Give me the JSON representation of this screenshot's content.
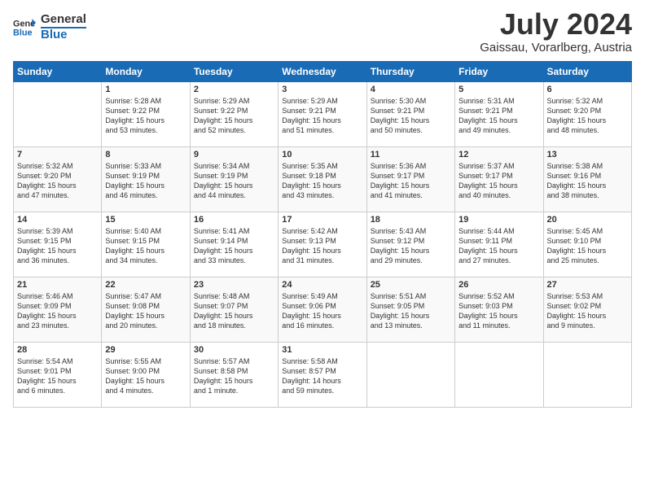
{
  "header": {
    "logo_line1": "General",
    "logo_line2": "Blue",
    "month": "July 2024",
    "location": "Gaissau, Vorarlberg, Austria"
  },
  "days_of_week": [
    "Sunday",
    "Monday",
    "Tuesday",
    "Wednesday",
    "Thursday",
    "Friday",
    "Saturday"
  ],
  "weeks": [
    [
      {
        "day": "",
        "info": ""
      },
      {
        "day": "1",
        "info": "Sunrise: 5:28 AM\nSunset: 9:22 PM\nDaylight: 15 hours\nand 53 minutes."
      },
      {
        "day": "2",
        "info": "Sunrise: 5:29 AM\nSunset: 9:22 PM\nDaylight: 15 hours\nand 52 minutes."
      },
      {
        "day": "3",
        "info": "Sunrise: 5:29 AM\nSunset: 9:21 PM\nDaylight: 15 hours\nand 51 minutes."
      },
      {
        "day": "4",
        "info": "Sunrise: 5:30 AM\nSunset: 9:21 PM\nDaylight: 15 hours\nand 50 minutes."
      },
      {
        "day": "5",
        "info": "Sunrise: 5:31 AM\nSunset: 9:21 PM\nDaylight: 15 hours\nand 49 minutes."
      },
      {
        "day": "6",
        "info": "Sunrise: 5:32 AM\nSunset: 9:20 PM\nDaylight: 15 hours\nand 48 minutes."
      }
    ],
    [
      {
        "day": "7",
        "info": "Sunrise: 5:32 AM\nSunset: 9:20 PM\nDaylight: 15 hours\nand 47 minutes."
      },
      {
        "day": "8",
        "info": "Sunrise: 5:33 AM\nSunset: 9:19 PM\nDaylight: 15 hours\nand 46 minutes."
      },
      {
        "day": "9",
        "info": "Sunrise: 5:34 AM\nSunset: 9:19 PM\nDaylight: 15 hours\nand 44 minutes."
      },
      {
        "day": "10",
        "info": "Sunrise: 5:35 AM\nSunset: 9:18 PM\nDaylight: 15 hours\nand 43 minutes."
      },
      {
        "day": "11",
        "info": "Sunrise: 5:36 AM\nSunset: 9:17 PM\nDaylight: 15 hours\nand 41 minutes."
      },
      {
        "day": "12",
        "info": "Sunrise: 5:37 AM\nSunset: 9:17 PM\nDaylight: 15 hours\nand 40 minutes."
      },
      {
        "day": "13",
        "info": "Sunrise: 5:38 AM\nSunset: 9:16 PM\nDaylight: 15 hours\nand 38 minutes."
      }
    ],
    [
      {
        "day": "14",
        "info": "Sunrise: 5:39 AM\nSunset: 9:15 PM\nDaylight: 15 hours\nand 36 minutes."
      },
      {
        "day": "15",
        "info": "Sunrise: 5:40 AM\nSunset: 9:15 PM\nDaylight: 15 hours\nand 34 minutes."
      },
      {
        "day": "16",
        "info": "Sunrise: 5:41 AM\nSunset: 9:14 PM\nDaylight: 15 hours\nand 33 minutes."
      },
      {
        "day": "17",
        "info": "Sunrise: 5:42 AM\nSunset: 9:13 PM\nDaylight: 15 hours\nand 31 minutes."
      },
      {
        "day": "18",
        "info": "Sunrise: 5:43 AM\nSunset: 9:12 PM\nDaylight: 15 hours\nand 29 minutes."
      },
      {
        "day": "19",
        "info": "Sunrise: 5:44 AM\nSunset: 9:11 PM\nDaylight: 15 hours\nand 27 minutes."
      },
      {
        "day": "20",
        "info": "Sunrise: 5:45 AM\nSunset: 9:10 PM\nDaylight: 15 hours\nand 25 minutes."
      }
    ],
    [
      {
        "day": "21",
        "info": "Sunrise: 5:46 AM\nSunset: 9:09 PM\nDaylight: 15 hours\nand 23 minutes."
      },
      {
        "day": "22",
        "info": "Sunrise: 5:47 AM\nSunset: 9:08 PM\nDaylight: 15 hours\nand 20 minutes."
      },
      {
        "day": "23",
        "info": "Sunrise: 5:48 AM\nSunset: 9:07 PM\nDaylight: 15 hours\nand 18 minutes."
      },
      {
        "day": "24",
        "info": "Sunrise: 5:49 AM\nSunset: 9:06 PM\nDaylight: 15 hours\nand 16 minutes."
      },
      {
        "day": "25",
        "info": "Sunrise: 5:51 AM\nSunset: 9:05 PM\nDaylight: 15 hours\nand 13 minutes."
      },
      {
        "day": "26",
        "info": "Sunrise: 5:52 AM\nSunset: 9:03 PM\nDaylight: 15 hours\nand 11 minutes."
      },
      {
        "day": "27",
        "info": "Sunrise: 5:53 AM\nSunset: 9:02 PM\nDaylight: 15 hours\nand 9 minutes."
      }
    ],
    [
      {
        "day": "28",
        "info": "Sunrise: 5:54 AM\nSunset: 9:01 PM\nDaylight: 15 hours\nand 6 minutes."
      },
      {
        "day": "29",
        "info": "Sunrise: 5:55 AM\nSunset: 9:00 PM\nDaylight: 15 hours\nand 4 minutes."
      },
      {
        "day": "30",
        "info": "Sunrise: 5:57 AM\nSunset: 8:58 PM\nDaylight: 15 hours\nand 1 minute."
      },
      {
        "day": "31",
        "info": "Sunrise: 5:58 AM\nSunset: 8:57 PM\nDaylight: 14 hours\nand 59 minutes."
      },
      {
        "day": "",
        "info": ""
      },
      {
        "day": "",
        "info": ""
      },
      {
        "day": "",
        "info": ""
      }
    ]
  ]
}
